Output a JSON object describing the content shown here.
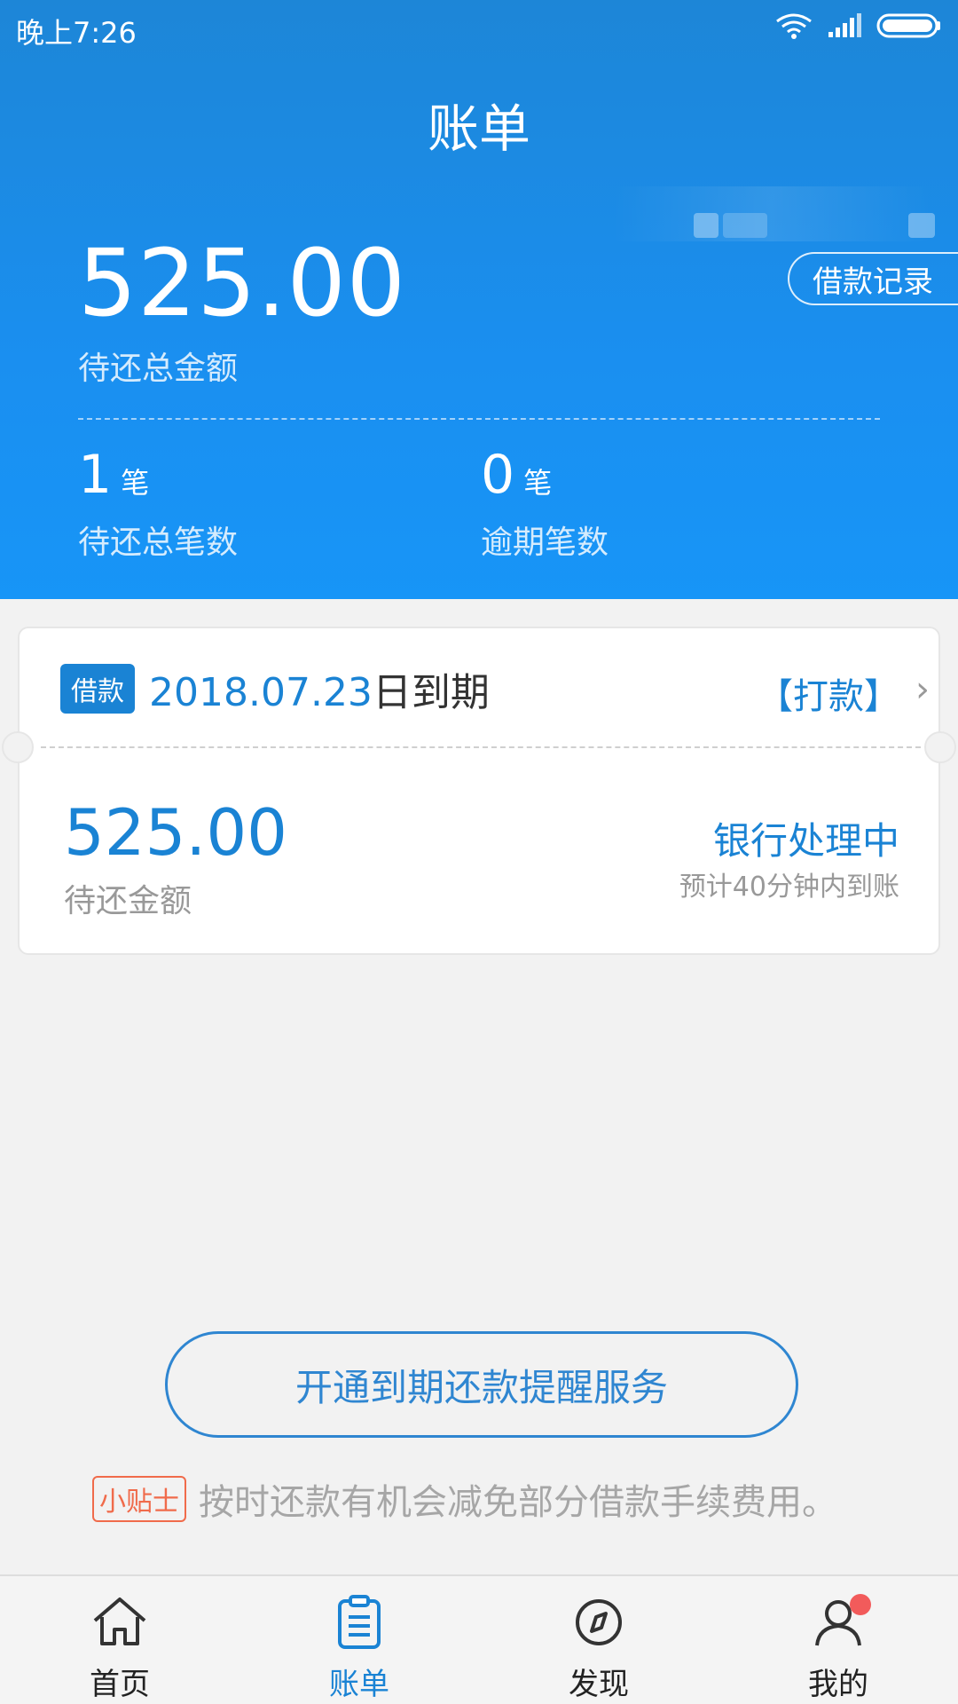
{
  "status_bar": {
    "time": "晚上7:26"
  },
  "header": {
    "title": "账单",
    "total_amount": "525.00",
    "total_amount_label": "待还总金额",
    "loan_record_button": "借款记录",
    "stats": {
      "pending_count": "1",
      "pending_unit": "笔",
      "pending_label": "待还总笔数",
      "overdue_count": "0",
      "overdue_unit": "笔",
      "overdue_label": "逾期笔数"
    }
  },
  "card": {
    "badge": "借款",
    "due_date": "2018.07.23",
    "due_suffix": "日到期",
    "pay_link": "【打款】",
    "amount": "525.00",
    "amount_label": "待还金额",
    "status_title": "银行处理中",
    "status_sub": "预计40分钟内到账"
  },
  "reminder_button": "开通到期还款提醒服务",
  "tip": {
    "badge": "小贴士",
    "text": "按时还款有机会减免部分借款手续费用。"
  },
  "bottom_nav": {
    "items": [
      {
        "label": "首页",
        "icon": "home-icon",
        "active": false
      },
      {
        "label": "账单",
        "icon": "bill-icon",
        "active": true
      },
      {
        "label": "发现",
        "icon": "compass-icon",
        "active": false
      },
      {
        "label": "我的",
        "icon": "user-icon",
        "active": false
      }
    ]
  },
  "colors": {
    "primary": "#1a83d4",
    "header_blue": "#1a8ff0",
    "tip_orange": "#f06b4b",
    "notification_red": "#f25b5b"
  }
}
